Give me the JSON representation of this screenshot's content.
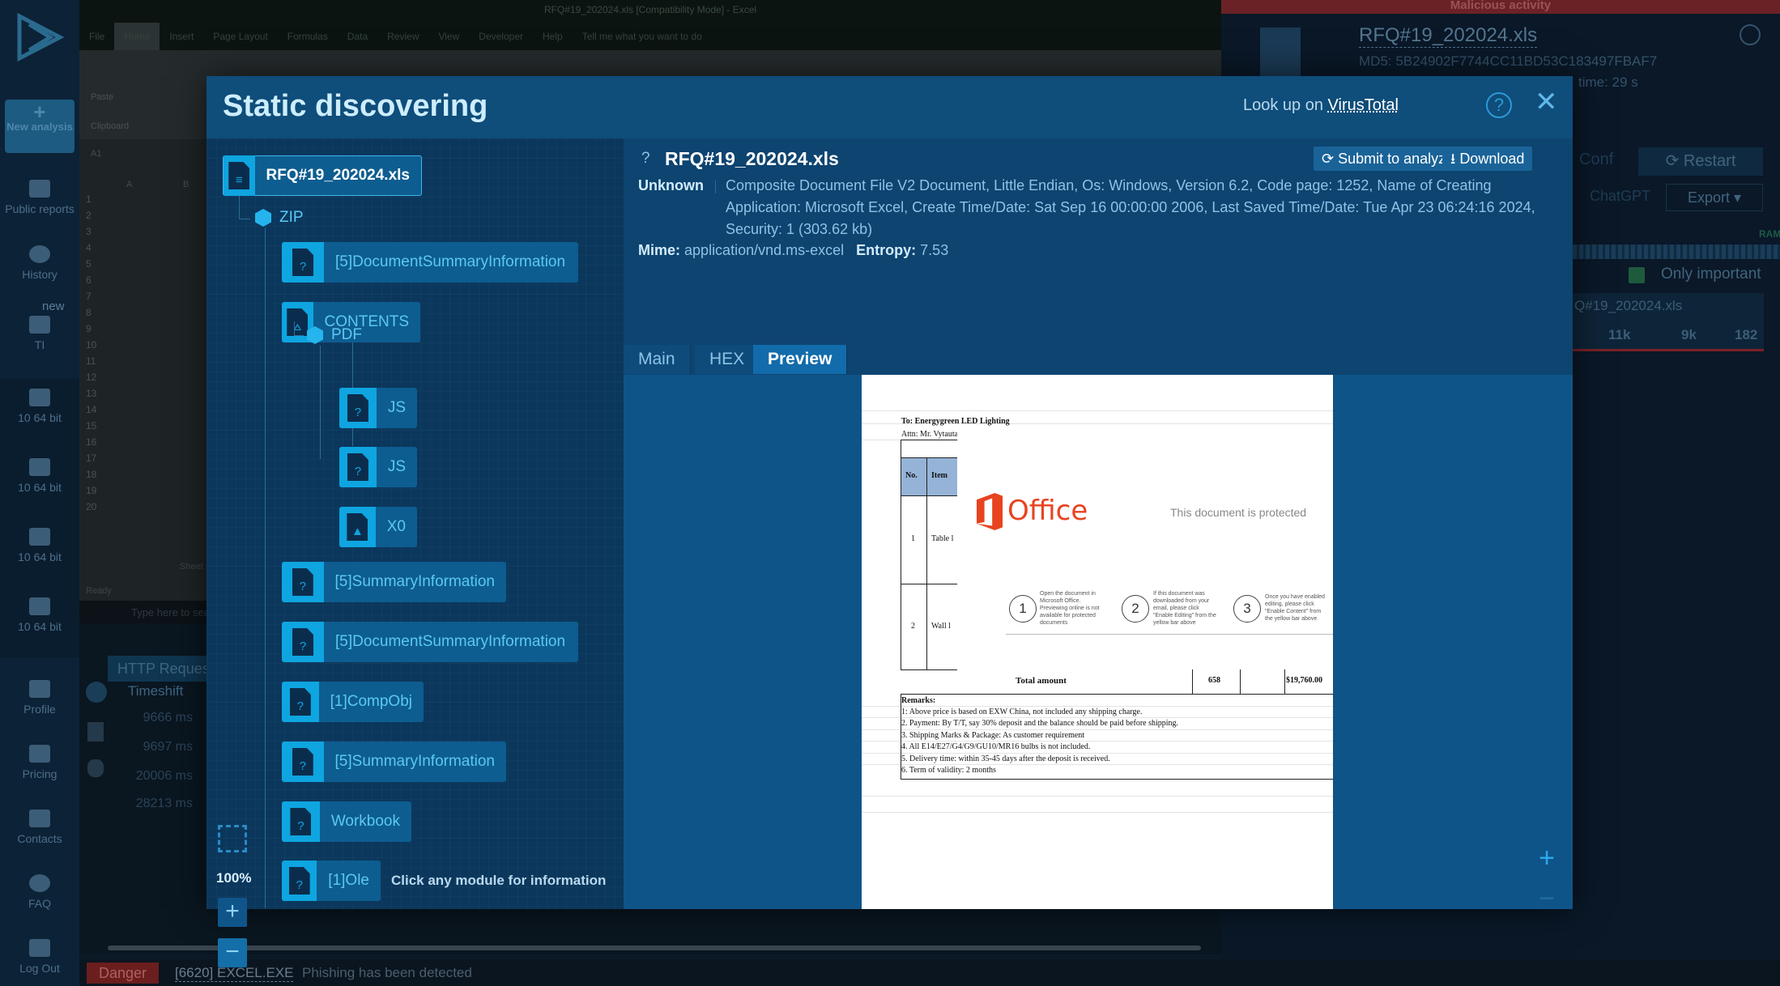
{
  "sidebar": {
    "new_analysis": "New analysis",
    "items": [
      {
        "label": "Public reports",
        "icon": "report-icon"
      },
      {
        "label": "History",
        "icon": "history-icon"
      },
      {
        "label": "TI",
        "badge": "new",
        "icon": "ti-icon"
      },
      {
        "label": "10 64 bit",
        "icon": "windows-icon"
      },
      {
        "label": "10 64 bit",
        "icon": "windows-icon"
      },
      {
        "label": "10 64 bit",
        "icon": "windows-icon"
      },
      {
        "label": "10 64 bit",
        "icon": "windows-icon"
      },
      {
        "label": "Profile",
        "icon": "user-icon"
      },
      {
        "label": "Pricing",
        "icon": "cart-icon"
      },
      {
        "label": "Contacts",
        "icon": "mail-icon"
      },
      {
        "label": "FAQ",
        "icon": "question-icon"
      },
      {
        "label": "Log Out",
        "icon": "logout-icon"
      }
    ]
  },
  "excel": {
    "title": "RFQ#19_202024.xls [Compatibility Mode] - Excel",
    "tabs": [
      "File",
      "Home",
      "Insert",
      "Page Layout",
      "Formulas",
      "Data",
      "Review",
      "View",
      "Developer",
      "Help",
      "Tell me what you want to do"
    ],
    "paste": "Paste",
    "clipboard": "Clipboard",
    "cell_ref": "A1",
    "col_a": "A",
    "col_b": "B",
    "status": "Ready",
    "sheet": "Sheet",
    "search_placeholder": "Type here to search"
  },
  "http_panel": {
    "title": "HTTP Requests",
    "column": "Timeshift",
    "rows": [
      "9666 ms",
      "9697 ms",
      "20006 ms",
      "28213 ms"
    ]
  },
  "status_bar": {
    "level": "Danger",
    "process": "[6620] EXCEL.EXE",
    "message": "Phishing has been detected"
  },
  "task_panel": {
    "verdict": "Malicious activity",
    "filename": "RFQ#19_202024.xls",
    "md5": "MD5: 5B24902F7744CC11BD53C183497FBAF7",
    "time": "time: 29 s",
    "conf": "Conf",
    "restart": "Restart",
    "chatgpt": "ChatGPT",
    "export": "Export",
    "ram": "RAM",
    "only_important": "Only important",
    "process_name": "Q#19_202024.xls",
    "stats": [
      "11k",
      "9k",
      "182"
    ]
  },
  "modal": {
    "title": "Static discovering",
    "lookup_prefix": "Look up on",
    "lookup_link": "VirusTotal",
    "tree": {
      "root": "RFQ#19_202024.xls",
      "zip": "ZIP",
      "pdf": "PDF",
      "nodes": [
        "[5]DocumentSummaryInformation",
        "CONTENTS",
        "JS",
        "JS",
        "X0",
        "[5]SummaryInformation",
        "[5]DocumentSummaryInformation",
        "[1]CompObj",
        "[5]SummaryInformation",
        "Workbook",
        "[1]Ole"
      ],
      "zoom": "100%",
      "hint": "Click any module for information"
    },
    "detail": {
      "filename": "RFQ#19_202024.xls",
      "submit": "Submit to analyze",
      "download": "Download",
      "type_label": "Unknown",
      "description": "Composite Document File V2 Document, Little Endian, Os: Windows, Version 6.2, Code page: 1252, Name of Creating Application: Microsoft Excel, Create Time/Date: Sat Sep 16 00:00:00 2006, Last Saved Time/Date: Tue Apr 23 06:24:16 2024, Security: 1 (303.62 kb)",
      "mime_label": "Mime:",
      "mime": "application/vnd.ms-excel",
      "entropy_label": "Entropy:",
      "entropy": "7.53",
      "tabs": [
        "Main",
        "HEX",
        "Preview"
      ],
      "active_tab": "Preview"
    },
    "preview_doc": {
      "to": "To: Energygreen LED Lighting",
      "attn": "Attn: Mr. Vytauta",
      "col_no": "No.",
      "col_item": "Item",
      "rows": [
        {
          "no": "1",
          "item": "Table l"
        },
        {
          "no": "2",
          "item": "Wall l"
        }
      ],
      "office_logo": "Office",
      "protected": "This document is protected",
      "steps": [
        {
          "n": "1",
          "text": "Open the document in Microsoft Office. Previewing online is not available for protected documents"
        },
        {
          "n": "2",
          "text": "If this document was downloaded from your email, please click \"Enable Editing\" from the yellow bar above"
        },
        {
          "n": "3",
          "text": "Once you have enabled editing, please click \"Enable Content\" from the yellow bar above"
        }
      ],
      "total_label": "Total amount",
      "total_qty": "658",
      "total_amount": "$19,760.00",
      "remarks_title": "Remarks:",
      "remarks": [
        "1: Above price is based on EXW China, not included any shipping charge.",
        "2. Payment: By T/T, say 30% deposit and the balance should be paid before shipping.",
        "3. Shipping Marks & Package: As customer requirement",
        "4. All E14/E27/G4/G9/GU10/MR16 bulbs is not included.",
        "5. Delivery time: within 35-45 days after the deposit is received.",
        "6. Term of validity: 2 months"
      ],
      "colors": {
        "header_fill": "#95b3d7",
        "office_red": "#e8431f"
      }
    }
  }
}
